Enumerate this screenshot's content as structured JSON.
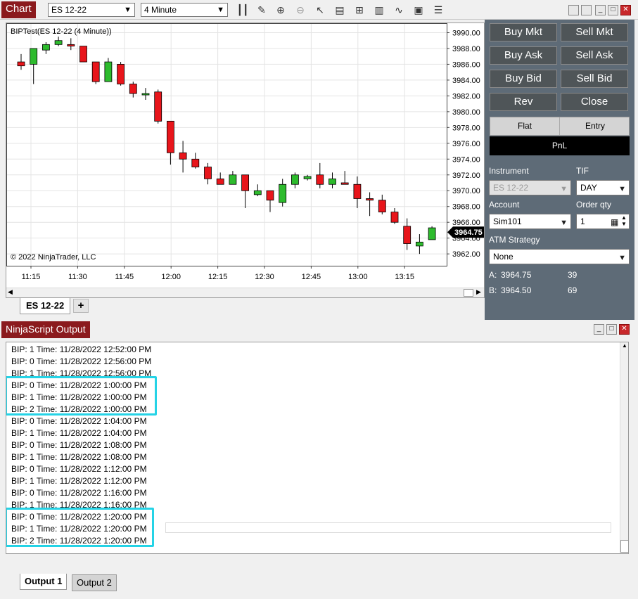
{
  "chart_window": {
    "title": "Chart",
    "instrument_select": "ES 12-22",
    "interval_select": "4 Minute",
    "toolbar_icons": [
      "bar-type-icon",
      "draw-pencil-icon",
      "zoom-in-icon",
      "zoom-out-icon",
      "pointer-icon",
      "data-box-icon",
      "properties-icon",
      "indicators-icon",
      "strategies-icon",
      "templates-icon",
      "chart-trader-icon",
      "list-icon"
    ],
    "chart_label": "BIPTest(ES 12-22 (4 Minute))",
    "copyright": "© 2022 NinjaTrader, LLC",
    "last_price_label": "3964.75",
    "document_tab": "ES 12-22",
    "add_tab": "+",
    "up_color": "#2dbb2d",
    "down_color": "#e8151b"
  },
  "chart_data": {
    "type": "candlestick",
    "y_ticks": [
      "3990.00",
      "3988.00",
      "3986.00",
      "3984.00",
      "3982.00",
      "3980.00",
      "3978.00",
      "3976.00",
      "3974.00",
      "3972.00",
      "3970.00",
      "3968.00",
      "3966.00",
      "3964.00",
      "3962.00"
    ],
    "x_ticks": [
      "11:15",
      "11:30",
      "11:45",
      "12:00",
      "12:15",
      "12:30",
      "12:45",
      "13:00",
      "13:15"
    ],
    "ylim": [
      3960.5,
      3991.2
    ],
    "candles": [
      {
        "o": 3986.3,
        "h": 3987.3,
        "l": 3985.3,
        "c": 3985.8
      },
      {
        "o": 3986.0,
        "h": 3988.0,
        "l": 3983.5,
        "c": 3988.0
      },
      {
        "o": 3987.8,
        "h": 3988.8,
        "l": 3987.3,
        "c": 3988.5
      },
      {
        "o": 3988.5,
        "h": 3989.5,
        "l": 3988.3,
        "c": 3989.0
      },
      {
        "o": 3988.5,
        "h": 3989.3,
        "l": 3987.8,
        "c": 3988.3
      },
      {
        "o": 3988.3,
        "h": 3988.3,
        "l": 3986.3,
        "c": 3986.3
      },
      {
        "o": 3986.3,
        "h": 3986.3,
        "l": 3983.5,
        "c": 3983.8
      },
      {
        "o": 3983.8,
        "h": 3986.8,
        "l": 3983.8,
        "c": 3986.3
      },
      {
        "o": 3986.0,
        "h": 3986.3,
        "l": 3983.3,
        "c": 3983.5
      },
      {
        "o": 3983.5,
        "h": 3983.8,
        "l": 3981.8,
        "c": 3982.3
      },
      {
        "o": 3982.3,
        "h": 3983.0,
        "l": 3981.5,
        "c": 3982.3
      },
      {
        "o": 3982.5,
        "h": 3982.8,
        "l": 3978.5,
        "c": 3978.8
      },
      {
        "o": 3978.8,
        "h": 3978.8,
        "l": 3973.3,
        "c": 3974.8
      },
      {
        "o": 3974.8,
        "h": 3976.3,
        "l": 3972.3,
        "c": 3974.0
      },
      {
        "o": 3974.0,
        "h": 3974.8,
        "l": 3972.8,
        "c": 3973.0
      },
      {
        "o": 3973.0,
        "h": 3973.5,
        "l": 3970.8,
        "c": 3971.5
      },
      {
        "o": 3971.5,
        "h": 3972.3,
        "l": 3970.8,
        "c": 3970.8
      },
      {
        "o": 3970.8,
        "h": 3972.5,
        "l": 3970.8,
        "c": 3972.0
      },
      {
        "o": 3972.0,
        "h": 3972.0,
        "l": 3967.8,
        "c": 3970.0
      },
      {
        "o": 3969.5,
        "h": 3970.8,
        "l": 3969.3,
        "c": 3970.0
      },
      {
        "o": 3970.0,
        "h": 3970.0,
        "l": 3967.3,
        "c": 3968.8
      },
      {
        "o": 3968.5,
        "h": 3971.5,
        "l": 3968.0,
        "c": 3970.8
      },
      {
        "o": 3970.8,
        "h": 3972.3,
        "l": 3970.3,
        "c": 3972.0
      },
      {
        "o": 3971.5,
        "h": 3972.0,
        "l": 3971.3,
        "c": 3971.8
      },
      {
        "o": 3972.0,
        "h": 3973.5,
        "l": 3970.3,
        "c": 3970.8
      },
      {
        "o": 3970.8,
        "h": 3972.3,
        "l": 3970.3,
        "c": 3971.5
      },
      {
        "o": 3971.0,
        "h": 3972.5,
        "l": 3970.8,
        "c": 3970.8
      },
      {
        "o": 3970.8,
        "h": 3971.8,
        "l": 3967.8,
        "c": 3969.0
      },
      {
        "o": 3969.0,
        "h": 3969.8,
        "l": 3966.8,
        "c": 3968.8
      },
      {
        "o": 3968.8,
        "h": 3969.5,
        "l": 3967.0,
        "c": 3967.3
      },
      {
        "o": 3967.3,
        "h": 3967.8,
        "l": 3965.8,
        "c": 3966.0
      },
      {
        "o": 3965.5,
        "h": 3966.5,
        "l": 3962.5,
        "c": 3963.3
      },
      {
        "o": 3963.0,
        "h": 3964.5,
        "l": 3962.0,
        "c": 3963.5
      },
      {
        "o": 3963.8,
        "h": 3965.5,
        "l": 3963.8,
        "c": 3965.3
      }
    ]
  },
  "trade_panel": {
    "buttons": [
      {
        "label": "Buy Mkt",
        "name": "buy-mkt-button"
      },
      {
        "label": "Sell Mkt",
        "name": "sell-mkt-button"
      },
      {
        "label": "Buy Ask",
        "name": "buy-ask-button"
      },
      {
        "label": "Sell Ask",
        "name": "sell-ask-button"
      },
      {
        "label": "Buy Bid",
        "name": "buy-bid-button"
      },
      {
        "label": "Sell Bid",
        "name": "sell-bid-button"
      },
      {
        "label": "Rev",
        "name": "rev-button"
      },
      {
        "label": "Close",
        "name": "close-position-button"
      }
    ],
    "position": {
      "flat": "Flat",
      "entry": "Entry",
      "pnl": "PnL"
    },
    "instrument_label": "Instrument",
    "instrument_value": "ES 12-22",
    "tif_label": "TIF",
    "tif_value": "DAY",
    "account_label": "Account",
    "account_value": "Sim101",
    "order_qty_label": "Order qty",
    "order_qty_value": "1",
    "atm_label": "ATM Strategy",
    "atm_value": "None",
    "ask": {
      "label": "A:",
      "price": "3964.75",
      "size": "39"
    },
    "bid": {
      "label": "B:",
      "price": "3964.50",
      "size": "69"
    }
  },
  "output_window": {
    "title": "NinjaScript Output",
    "lines": [
      "BIP: 1 Time: 11/28/2022 12:52:00 PM",
      "BIP: 0 Time: 11/28/2022 12:56:00 PM",
      "BIP: 1 Time: 11/28/2022 12:56:00 PM",
      "BIP: 0 Time: 11/28/2022 1:00:00 PM",
      "BIP: 1 Time: 11/28/2022 1:00:00 PM",
      "BIP: 2 Time: 11/28/2022 1:00:00 PM",
      "BIP: 0 Time: 11/28/2022 1:04:00 PM",
      "BIP: 1 Time: 11/28/2022 1:04:00 PM",
      "BIP: 0 Time: 11/28/2022 1:08:00 PM",
      "BIP: 1 Time: 11/28/2022 1:08:00 PM",
      "BIP: 0 Time: 11/28/2022 1:12:00 PM",
      "BIP: 1 Time: 11/28/2022 1:12:00 PM",
      "BIP: 0 Time: 11/28/2022 1:16:00 PM",
      "BIP: 1 Time: 11/28/2022 1:16:00 PM",
      "BIP: 0 Time: 11/28/2022 1:20:00 PM",
      "BIP: 1 Time: 11/28/2022 1:20:00 PM",
      "BIP: 2 Time: 11/28/2022 1:20:00 PM"
    ],
    "highlight_color": "#25d3e6",
    "tabs": [
      "Output 1",
      "Output 2"
    ]
  }
}
